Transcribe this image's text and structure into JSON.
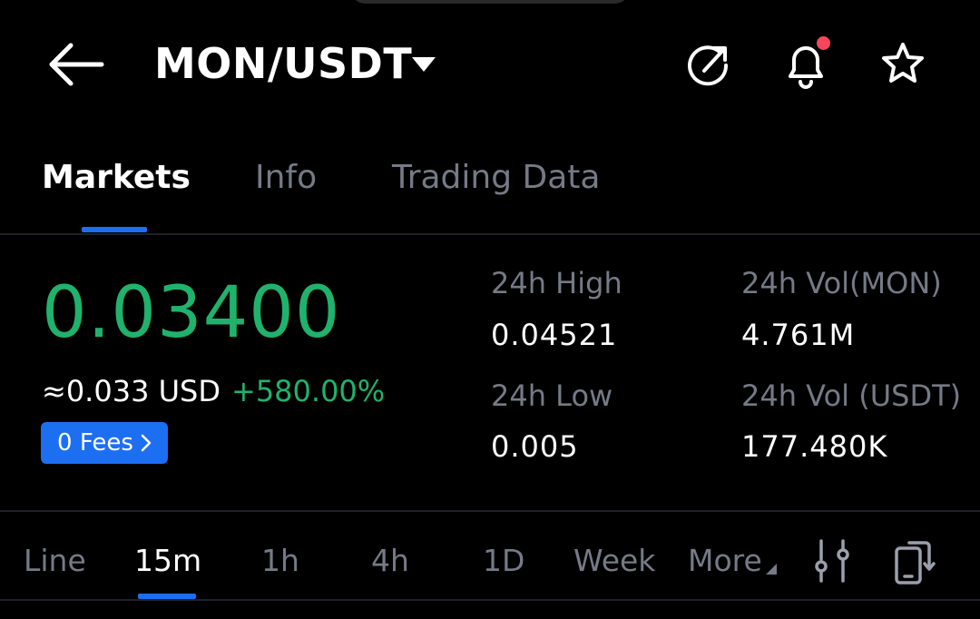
{
  "header": {
    "pair": "MON/USDT",
    "icons": [
      "back-arrow-icon",
      "share-icon",
      "bell-icon",
      "star-icon"
    ],
    "has_notification": true
  },
  "tabs": [
    {
      "label": "Markets",
      "active": true
    },
    {
      "label": "Info",
      "active": false
    },
    {
      "label": "Trading Data",
      "active": false
    }
  ],
  "price": {
    "last": "0.03400",
    "approx_usd": "≈0.033 USD",
    "change": "+580.00%",
    "fees_label": "0 Fees"
  },
  "stats": {
    "high_label": "24h High",
    "high_value": "0.04521",
    "low_label": "24h Low",
    "low_value": "0.005",
    "vol_mon_label": "24h Vol(MON)",
    "vol_mon_value": "4.761M",
    "vol_usdt_label": "24h Vol (USDT)",
    "vol_usdt_value": "177.480K"
  },
  "intervals": {
    "items": [
      "Line",
      "15m",
      "1h",
      "4h",
      "1D",
      "Week",
      "More"
    ],
    "selected": "15m"
  },
  "colors": {
    "background": "#000000",
    "up_green": "#20b26c",
    "accent_blue": "#1d6ff2",
    "muted_text": "#757a86",
    "notification_red": "#f6465d"
  }
}
